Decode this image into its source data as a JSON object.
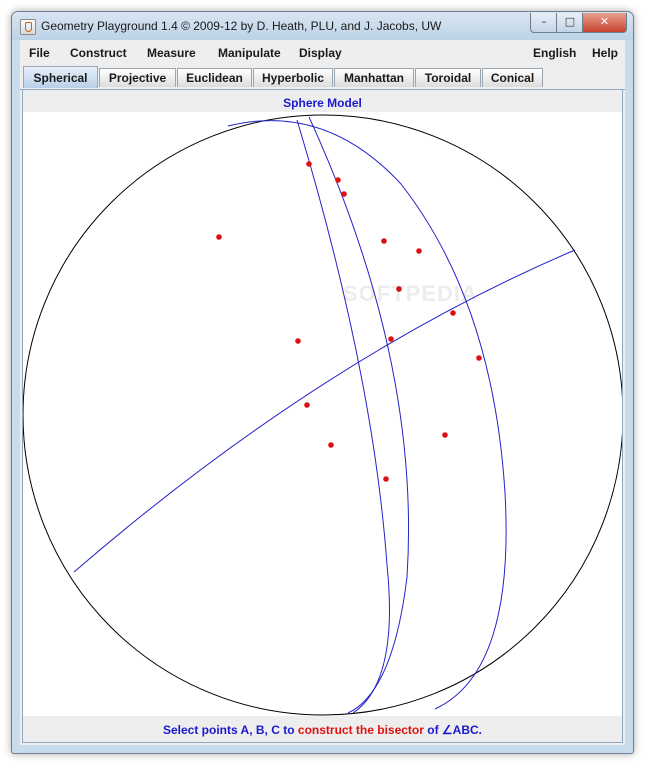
{
  "window": {
    "title": "Geometry Playground 1.4 © 2009-12 by D. Heath, PLU, and J. Jacobs, UW",
    "controls": {
      "minimize": "–",
      "maximize": "□",
      "close": "✕"
    }
  },
  "menubar": {
    "left": [
      "File",
      "Construct",
      "Measure",
      "Manipulate",
      "Display"
    ],
    "right": [
      "English",
      "Help"
    ]
  },
  "tabs": [
    "Spherical",
    "Projective",
    "Euclidean",
    "Hyperbolic",
    "Manhattan",
    "Toroidal",
    "Conical"
  ],
  "active_tab": "Spherical",
  "model_title": "Sphere Model",
  "status": {
    "part1": "Select points A, B, C to ",
    "part2": "construct the bisector",
    "part3": " of ∠ABC."
  },
  "watermark": "SOFTPEDIA",
  "colors": {
    "line": "#2323c8",
    "point": "#dd1111",
    "circle": "#000000",
    "status_blue": "#1a1acc",
    "status_red": "#dd1111"
  }
}
